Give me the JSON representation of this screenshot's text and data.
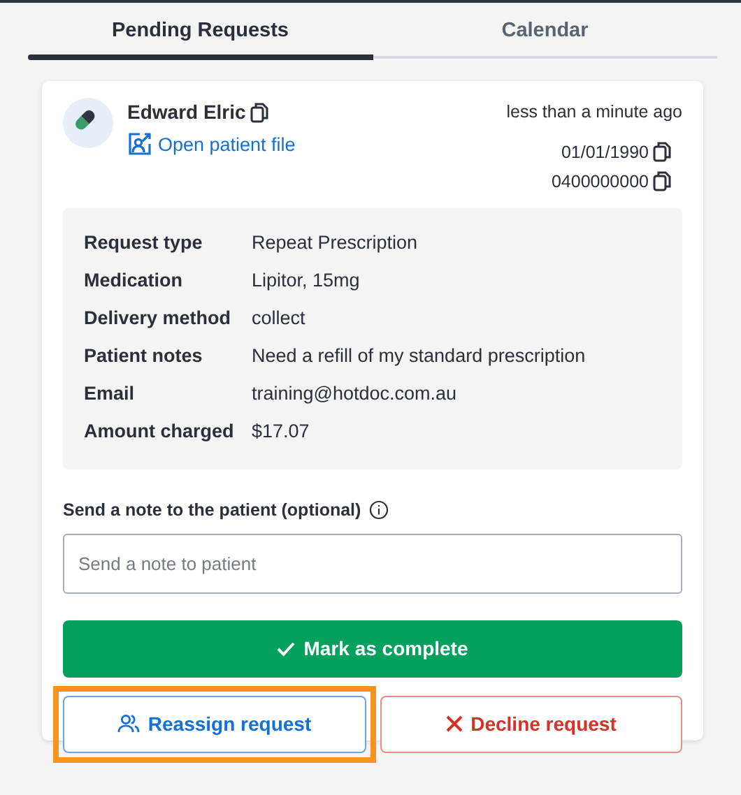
{
  "tabs": [
    {
      "label": "Pending Requests",
      "selected": true
    },
    {
      "label": "Calendar",
      "selected": false
    }
  ],
  "request": {
    "patient_name": "Edward Elric",
    "open_file_link": "Open patient file",
    "time_ago": "less than a minute ago",
    "date_of_birth": "01/01/1990",
    "phone": "0400000000",
    "details": [
      {
        "label": "Request type",
        "value": "Repeat Prescription"
      },
      {
        "label": "Medication",
        "value": "Lipitor, 15mg"
      },
      {
        "label": "Delivery method",
        "value": "collect"
      },
      {
        "label": "Patient notes",
        "value": "Need a refill of my standard prescription"
      },
      {
        "label": "Email",
        "value": "training@hotdoc.com.au"
      },
      {
        "label": "Amount charged",
        "value": "$17.07"
      }
    ],
    "note": {
      "label": "Send a note to the patient (optional)",
      "placeholder": "Send a note to patient"
    },
    "buttons": [
      {
        "kind": "complete",
        "label": "Mark as complete",
        "highlighted": false
      },
      {
        "kind": "reassign",
        "label": "Reassign request",
        "highlighted": true
      },
      {
        "kind": "decline",
        "label": "Decline request",
        "highlighted": false
      }
    ]
  }
}
